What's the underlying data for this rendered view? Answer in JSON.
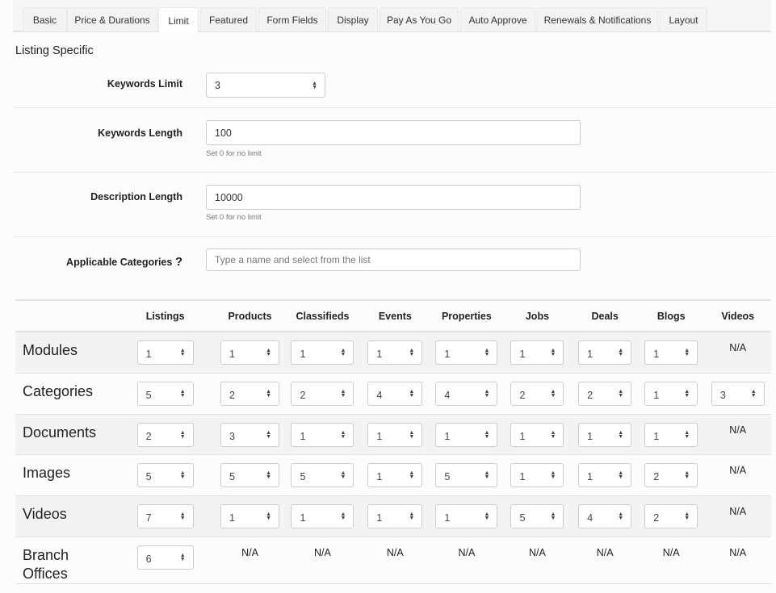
{
  "tabs": [
    "Basic",
    "Price & Durations",
    "Limit",
    "Featured",
    "Form Fields",
    "Display",
    "Pay As You Go",
    "Auto Approve",
    "Renewals & Notifications",
    "Layout"
  ],
  "active_tab": "Limit",
  "section_title": "Listing Specific",
  "fields": {
    "keywords_limit": {
      "label": "Keywords Limit",
      "value": "3"
    },
    "keywords_length": {
      "label": "Keywords Length",
      "value": "100",
      "help": "Set 0 for no limit"
    },
    "description_length": {
      "label": "Description Length",
      "value": "10000",
      "help": "Set 0 for no limit"
    },
    "applicable_categories": {
      "label": "Applicable Categories",
      "help_icon": "?",
      "placeholder": "Type a name and select from the list"
    }
  },
  "limits_table": {
    "columns": [
      "Listings",
      "Products",
      "Classifieds",
      "Events",
      "Properties",
      "Jobs",
      "Deals",
      "Blogs",
      "Videos"
    ],
    "rows": [
      {
        "label": "Modules",
        "values": [
          "1",
          "1",
          "1",
          "1",
          "1",
          "1",
          "1",
          "1",
          "N/A"
        ]
      },
      {
        "label": "Categories",
        "values": [
          "5",
          "2",
          "2",
          "4",
          "4",
          "2",
          "2",
          "1",
          "3"
        ]
      },
      {
        "label": "Documents",
        "values": [
          "2",
          "3",
          "1",
          "1",
          "1",
          "1",
          "1",
          "1",
          "N/A"
        ]
      },
      {
        "label": "Images",
        "values": [
          "5",
          "5",
          "5",
          "1",
          "5",
          "1",
          "1",
          "2",
          "N/A"
        ]
      },
      {
        "label": "Videos",
        "values": [
          "7",
          "1",
          "1",
          "1",
          "1",
          "5",
          "4",
          "2",
          "N/A"
        ]
      },
      {
        "label": "Branch Offices",
        "values": [
          "6",
          "N/A",
          "N/A",
          "N/A",
          "N/A",
          "N/A",
          "N/A",
          "N/A",
          "N/A"
        ]
      }
    ]
  }
}
